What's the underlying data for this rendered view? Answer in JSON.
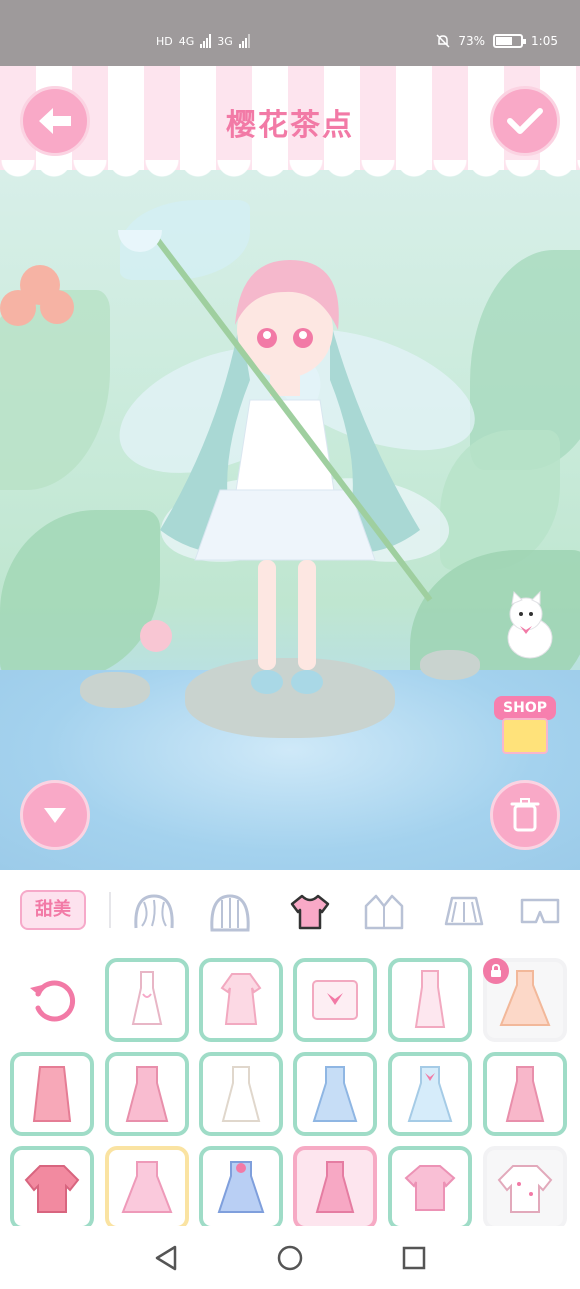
{
  "status_bar": {
    "hd": "HD",
    "net1": "4G",
    "net2": "3G",
    "battery_text": "73%",
    "battery_level": 0.73,
    "time": "1:05"
  },
  "header": {
    "title": "樱花茶点"
  },
  "scene": {
    "shop_label": "SHOP"
  },
  "categories": {
    "style_tag": "甜美",
    "items": [
      "hair-front",
      "hair-back",
      "top",
      "jacket",
      "skirt",
      "pants"
    ],
    "active": "top"
  },
  "grid": {
    "rows": [
      [
        "reset",
        "dress-white-heart",
        "dress-pink-puff",
        "top-pink-bow",
        "dress-pink-strap",
        "dress-peach-tiered"
      ],
      [
        "dress-coral-cami",
        "dress-pink-bow",
        "dress-white-mini",
        "dress-blue-ruffle",
        "dress-light-blue",
        "dress-pink-midi"
      ],
      [
        "top-pink-knit",
        "dress-pink-tiered",
        "dress-blue-bow",
        "dress-pink-sailor",
        "top-pink-blouse",
        "top-white-print"
      ]
    ]
  },
  "colors": {
    "accent": "#f27aa6",
    "item_border": "#9fdcc7",
    "button": "#f9a9c7"
  }
}
